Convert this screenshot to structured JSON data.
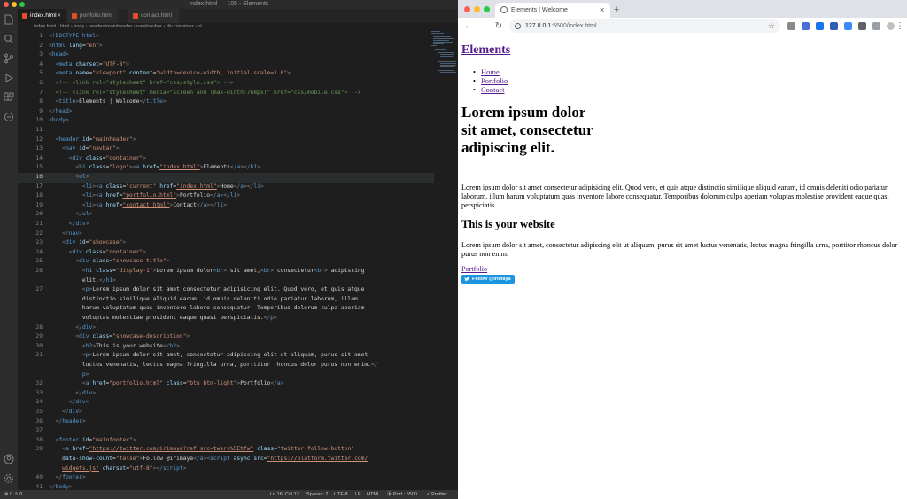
{
  "vscode": {
    "title": "index.html — 105 - Elements",
    "tabs": [
      {
        "label": "index.html",
        "active": true
      },
      {
        "label": "portfolio.html",
        "active": false
      },
      {
        "label": "contact.html",
        "active": false
      }
    ],
    "breadcrumb": "index.html › html › body › header#mainheader › nav#navbar › div.container › ul",
    "line_numbers": [
      "1",
      "2",
      "3",
      "4",
      "5",
      "6",
      "7",
      "8",
      "9",
      "10",
      "11",
      "12",
      "13",
      "14",
      "15",
      "16",
      "17",
      "18",
      "19",
      "20",
      "21",
      "22",
      "23",
      "24",
      "25",
      "26",
      "",
      "27",
      "",
      "",
      "",
      "28",
      "29",
      "30",
      "31",
      "",
      "",
      "32",
      "33",
      "34",
      "35",
      "36",
      "37",
      "38",
      "39",
      "",
      "",
      "40",
      "41"
    ],
    "statusbar": {
      "problems": "⊗ 0  ⚠ 0",
      "position": "Ln 16, Col 13",
      "spaces": "Spaces: 2",
      "encoding": "UTF-8",
      "eol": "LF",
      "language": "HTML",
      "port": "⦿ Port : 5500",
      "prettier": "✓ Prettier"
    }
  },
  "chrome": {
    "tab_title": "Elements | Welcome",
    "url_host": "127.0.0.1",
    "url_path": ":5500/index.html",
    "page": {
      "logo": "Elements",
      "nav_items": [
        "Home",
        "Portfolio",
        "Contact"
      ],
      "display_title": "Lorem ipsum dolor sit amet, consectetur adipiscing elit.",
      "lead_text": "Lorem ipsum dolor sit amet consectetur adipisicing elit. Quod vero, et quis atque distinctio similique aliquid earum, id omnis deleniti odio pariatur laborum, illum harum voluptatum quas inventore labore consequatur. Temporibus dolorum culpa aperiam voluptas molestiae provident eaque quasi perspiciatis.",
      "section_heading": "This is your website",
      "description_text": "Lorem ipsum dolor sit amet, consectetur adipiscing elit ut aliquam, purus sit amet luctus venenatis, lectus magna fringilla urna, porttitor rhoncus dolor purus non enim.",
      "portfolio_link": "Portfolio",
      "follow_button": "Follow @irimaya"
    }
  }
}
